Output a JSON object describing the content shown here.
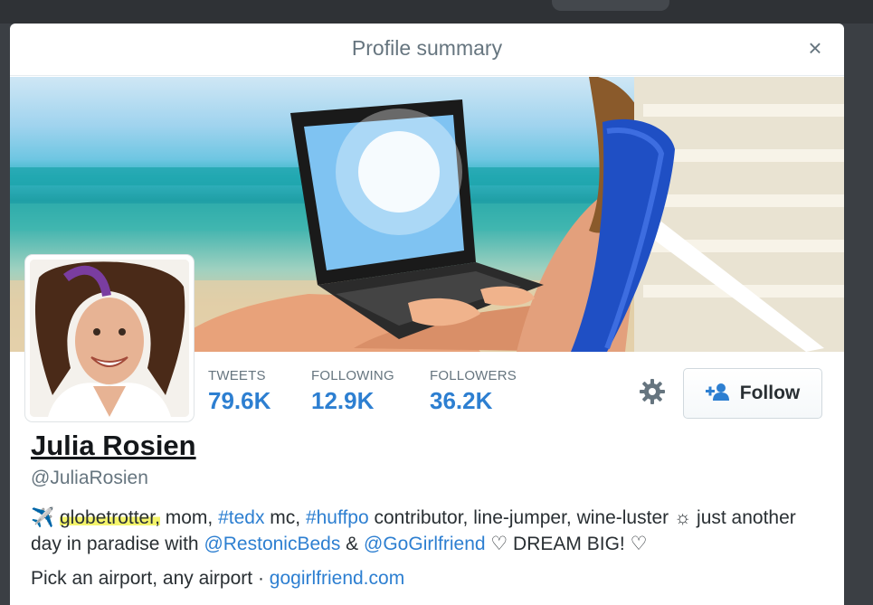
{
  "modal": {
    "title": "Profile summary",
    "close_label": "×"
  },
  "profile": {
    "name": "Julia Rosien",
    "handle": "@JuliaRosien",
    "stats": [
      {
        "label": "TWEETS",
        "value": "79.6K"
      },
      {
        "label": "FOLLOWING",
        "value": "12.9K"
      },
      {
        "label": "FOLLOWERS",
        "value": "36.2K"
      }
    ],
    "follow_label": "Follow",
    "bio": {
      "plane_icon": "✈️",
      "highlighted": "globetrotter,",
      "t1": " mom, ",
      "tag1": "#tedx",
      "t2": " mc, ",
      "tag2": "#huffpo",
      "t3": " contributor, line-jumper, wine-luster ☼ just another day in paradise with ",
      "mention1": "@RestonicBeds",
      "t4": " & ",
      "mention2": "@GoGirlfriend",
      "t5": " ♡ DREAM BIG! ♡"
    },
    "location": "Pick an airport, any airport",
    "separator": " · ",
    "website": "gogirlfriend.com"
  },
  "colors": {
    "link": "#2d7fd1",
    "highlight": "#f4f46b"
  },
  "icons": [
    "close-icon",
    "gear-icon",
    "add-user-icon",
    "airplane-icon"
  ]
}
